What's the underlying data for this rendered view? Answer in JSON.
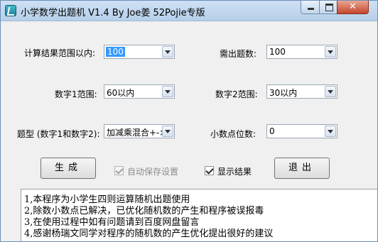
{
  "window": {
    "title": "小学数学出题机 V1.4 By Joe姜 52Pojie专版"
  },
  "form": {
    "range_label": "计算结果范围以内:",
    "range_value": "100",
    "count_label": "需出题数:",
    "count_value": "100",
    "num1_label": "数字1范围:",
    "num1_value": "60以内",
    "num2_label": "数字2范围:",
    "num2_value": "30以内",
    "type_label": "题型 (数字1和数字2):",
    "type_value": "加减乘混合+-×",
    "decimal_label": "小数点位数:",
    "decimal_value": "0"
  },
  "actions": {
    "generate_label": "生成",
    "autosave_label": "自动保存设置",
    "autosave_checked": true,
    "autosave_enabled": false,
    "show_result_label": "显示结果",
    "show_result_checked": true,
    "exit_label": "退出"
  },
  "notes": [
    "1,本程序为小学生四则运算随机出题使用",
    "2,除数小数点已解决，已优化随机数的产生和程序被误报毒",
    "3,在使用过程中如有问题请到百度网盘留言",
    "4,感谢杨瑞文同学对程序的随机数的产生优化提出很好的建议"
  ],
  "icons": {
    "app": "calculator-app-icon",
    "minimize": "minimize-icon",
    "maximize": "maximize-icon",
    "close": "close-icon",
    "dropdown": "chevron-down-icon",
    "check": "checkmark-icon"
  },
  "colors": {
    "selection": "#3399ff",
    "close_button": "#c5452d",
    "titlebar": "#b6cfea"
  }
}
